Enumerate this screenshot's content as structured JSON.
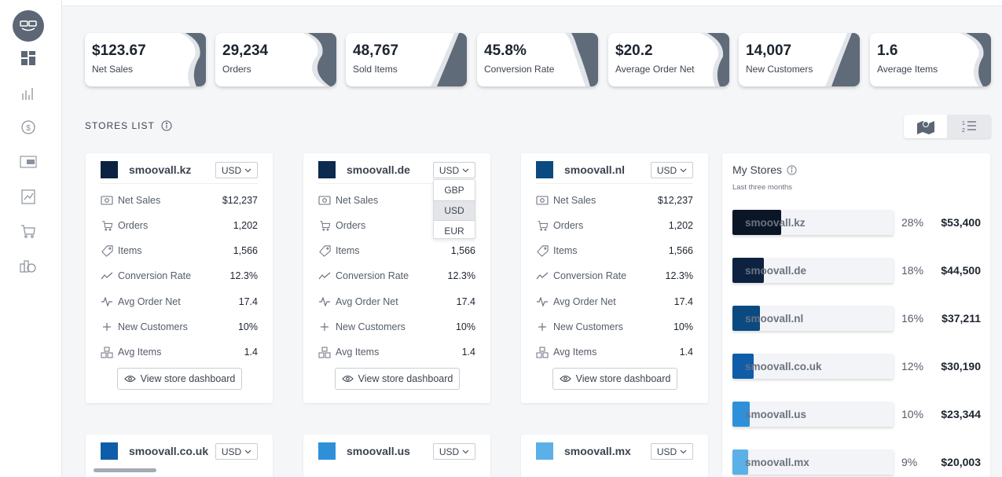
{
  "kpis": [
    {
      "value": "$123.67",
      "label": "Net Sales"
    },
    {
      "value": "29,234",
      "label": "Orders"
    },
    {
      "value": "48,767",
      "label": "Sold Items"
    },
    {
      "value": "45.8%",
      "label": "Conversion Rate"
    },
    {
      "value": "$20.2",
      "label": "Average Order Net"
    },
    {
      "value": "14,007",
      "label": "New Customers"
    },
    {
      "value": "1.6",
      "label": "Average Items"
    }
  ],
  "section": {
    "title": "STORES LIST"
  },
  "metric_labels": [
    "Net Sales",
    "Orders",
    "Items",
    "Conversion Rate",
    "Avg Order Net",
    "New Customers",
    "Avg Items"
  ],
  "stores": [
    {
      "name": "smoovall.kz",
      "currency": "USD",
      "color": "#0d2240",
      "values": [
        "$12,237",
        "1,202",
        "1,566",
        "12.3%",
        "17.4",
        "10%",
        "1.4"
      ],
      "button": "View store dashboard"
    },
    {
      "name": "smoovall.de",
      "currency": "USD",
      "color": "#0d2a4f",
      "values": [
        "",
        "",
        "1,566",
        "12.3%",
        "17.4",
        "10%",
        "1.4"
      ],
      "button": "View store dashboard"
    },
    {
      "name": "smoovall.nl",
      "currency": "USD",
      "color": "#0b4a80",
      "values": [
        "$12,237",
        "1,202",
        "1,566",
        "12.3%",
        "17.4",
        "10%",
        "1.4"
      ],
      "button": "View store dashboard"
    },
    {
      "name": "smoovall.co.uk",
      "currency": "USD",
      "color": "#0f5da8"
    },
    {
      "name": "smoovall.us",
      "currency": "USD",
      "color": "#2f90da"
    },
    {
      "name": "smoovall.mx",
      "currency": "USD",
      "color": "#5bb0e8"
    }
  ],
  "currency_dropdown": {
    "options": [
      "GBP",
      "USD",
      "EUR"
    ],
    "selected": "USD"
  },
  "my_stores": {
    "title": "My Stores",
    "subtitle": "Last three months",
    "rows": [
      {
        "name": "smoovall.kz",
        "percent": "28%",
        "share": 0.28,
        "amount": "$53,400",
        "color": "#0a1626"
      },
      {
        "name": "smoovall.de",
        "percent": "18%",
        "share": 0.18,
        "amount": "$44,500",
        "color": "#0d2240"
      },
      {
        "name": "smoovall.nl",
        "percent": "16%",
        "share": 0.16,
        "amount": "$37,211",
        "color": "#0b4a80"
      },
      {
        "name": "smoovall.co.uk",
        "percent": "12%",
        "share": 0.12,
        "amount": "$30,190",
        "color": "#0f5da8"
      },
      {
        "name": "smoovall.us",
        "percent": "10%",
        "share": 0.1,
        "amount": "$23,344",
        "color": "#2f90da"
      },
      {
        "name": "smoovall.mx",
        "percent": "9%",
        "share": 0.09,
        "amount": "$20,003",
        "color": "#5bb0e8"
      }
    ]
  },
  "icons": {
    "sidebar": [
      "logo-icon",
      "dashboard-icon",
      "bar-chart-icon",
      "currency-cycle-icon",
      "crm-icon",
      "report-icon",
      "cart-icon",
      "store-money-icon"
    ],
    "metrics": [
      "cash-icon",
      "cart-icon",
      "tag-icon",
      "trend-icon",
      "pulse-icon",
      "plus-icon",
      "boxes-icon"
    ]
  }
}
